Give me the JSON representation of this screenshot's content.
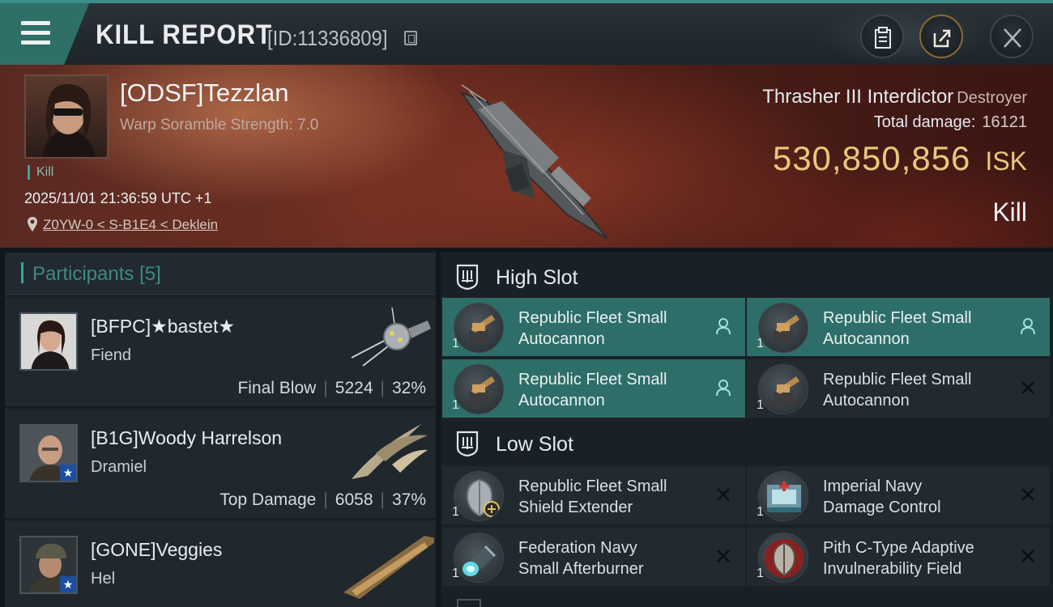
{
  "header": {
    "title": "KILL REPORT",
    "report_id": "[ID:11336809]",
    "buttons": [
      "clipboard-icon",
      "share-icon",
      "close-icon"
    ]
  },
  "victim": {
    "name": "[ODSF]Tezzlan",
    "subtitle": "Warp Soramble Strength: 7.0",
    "tag": "Kill",
    "datetime": "2025/11/01 21:36:59 UTC +1",
    "location": "Z0YW-0 < S-B1E4 < Deklein",
    "ship_name": "Thrasher III Interdictor",
    "ship_class": "Destroyer",
    "total_damage_label": "Total damage:",
    "total_damage": "16121",
    "isk_value": "530,850,856",
    "isk_unit": "ISK",
    "result": "Kill"
  },
  "participants": {
    "title": "Participants",
    "count": "[5]",
    "items": [
      {
        "name": "[BFPC]★bastet★",
        "ship": "Fiend",
        "role": "Final Blow",
        "damage": "5224",
        "percent": "32%",
        "badge": false
      },
      {
        "name": "[B1G]Woody Harrelson",
        "ship": "Dramiel",
        "role": "Top Damage",
        "damage": "6058",
        "percent": "37%",
        "badge": true
      },
      {
        "name": "[GONE]Veggies",
        "ship": "Hel",
        "badge": true
      }
    ]
  },
  "fitting": {
    "high_slot": {
      "label": "High Slot",
      "modules": [
        {
          "qty": "1",
          "name1": "Republic Fleet Small",
          "name2": "Autocannon",
          "active": true,
          "status": "person-icon"
        },
        {
          "qty": "1",
          "name1": "Republic Fleet Small",
          "name2": "Autocannon",
          "active": true,
          "status": "person-icon"
        },
        {
          "qty": "1",
          "name1": "Republic Fleet Small",
          "name2": "Autocannon",
          "active": true,
          "status": "person-icon"
        },
        {
          "qty": "1",
          "name1": "Republic Fleet Small",
          "name2": "Autocannon",
          "active": false,
          "status": "destroyed-x-icon"
        }
      ]
    },
    "low_slot": {
      "label": "Low Slot",
      "modules": [
        {
          "qty": "1",
          "name1": "Republic Fleet Small",
          "name2": "Shield Extender",
          "active": false,
          "status": "destroyed-x-icon"
        },
        {
          "qty": "1",
          "name1": "Imperial Navy",
          "name2": "Damage Control",
          "active": false,
          "status": "destroyed-x-icon"
        },
        {
          "qty": "1",
          "name1": "Federation Navy",
          "name2": "Small Afterburner",
          "active": false,
          "status": "destroyed-x-icon"
        },
        {
          "qty": "1",
          "name1": "Pith C-Type Adaptive",
          "name2": "Invulnerability Field",
          "active": false,
          "status": "destroyed-x-icon"
        }
      ]
    }
  },
  "colors": {
    "accent": "#3aa49a",
    "active_module": "#2e6e68",
    "isk": "#e9c77d",
    "hero": "#5a2a22"
  }
}
